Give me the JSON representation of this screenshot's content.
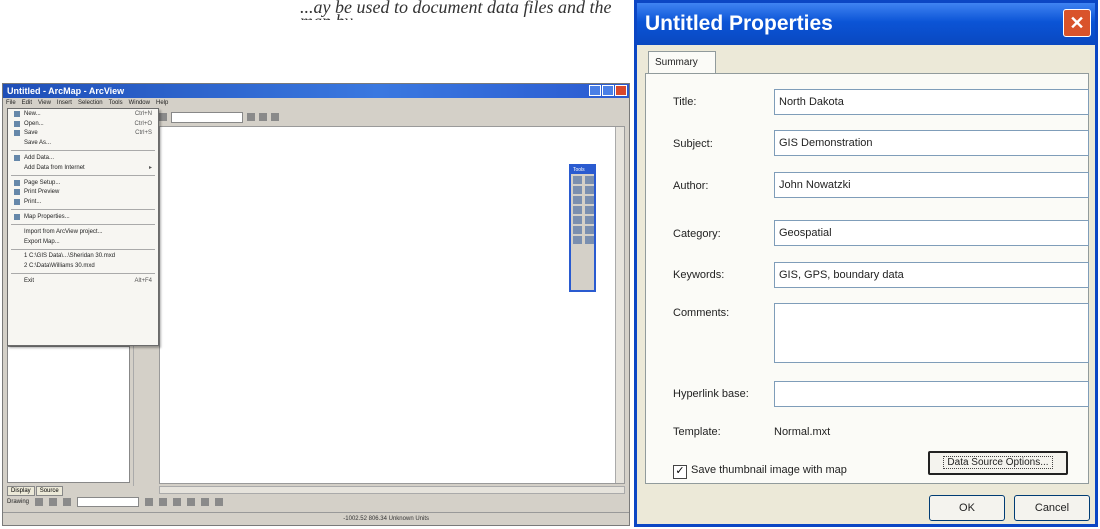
{
  "caption": "...ay be used to document data files and the map by...",
  "arcmap": {
    "title": "Untitled - ArcMap - ArcView",
    "menus": [
      "File",
      "Edit",
      "View",
      "Insert",
      "Selection",
      "Tools",
      "Window",
      "Help"
    ],
    "file_menu": [
      {
        "label": "New...",
        "shortcut": "Ctrl+N"
      },
      {
        "label": "Open...",
        "shortcut": "Ctrl+O"
      },
      {
        "label": "Save",
        "shortcut": "Ctrl+S"
      },
      {
        "label": "Save As...",
        "shortcut": ""
      },
      {
        "label": "Add Data...",
        "shortcut": ""
      },
      {
        "label": "Add Data from Internet",
        "shortcut": ""
      },
      {
        "label": "Page Setup...",
        "shortcut": ""
      },
      {
        "label": "Print Preview",
        "shortcut": ""
      },
      {
        "label": "Print...",
        "shortcut": ""
      },
      {
        "label": "Map Properties...",
        "shortcut": ""
      },
      {
        "label": "Import from ArcView project...",
        "shortcut": ""
      },
      {
        "label": "Export Map...",
        "shortcut": ""
      },
      {
        "label": "1 C:\\GIS Data\\...\\Sheridan 30.mxd",
        "shortcut": ""
      },
      {
        "label": "2 C:\\Data\\Williams 30.mxd",
        "shortcut": ""
      },
      {
        "label": "Exit",
        "shortcut": "Alt+F4"
      }
    ],
    "tools_title": "Tools",
    "toc_tabs": [
      "Display",
      "Source"
    ],
    "drawing_label": "Drawing",
    "status_text": "-1002.52 806.34 Unknown Units"
  },
  "dialog": {
    "title": "Untitled Properties",
    "tab": "Summary",
    "fields": {
      "title_label": "Title:",
      "title_value": "North Dakota",
      "subject_label": "Subject:",
      "subject_value": "GIS Demonstration",
      "author_label": "Author:",
      "author_value": "John Nowatzki",
      "category_label": "Category:",
      "category_value": "Geospatial",
      "keywords_label": "Keywords:",
      "keywords_value": "GIS, GPS, boundary data",
      "comments_label": "Comments:",
      "comments_value": "",
      "hyperlink_label": "Hyperlink base:",
      "hyperlink_value": "",
      "template_label": "Template:",
      "template_value": "Normal.mxt"
    },
    "thumbnail_checked": true,
    "thumbnail_label": "Save thumbnail image with map",
    "data_source_button": "Data Source Options...",
    "ok_button": "OK",
    "cancel_button": "Cancel"
  }
}
